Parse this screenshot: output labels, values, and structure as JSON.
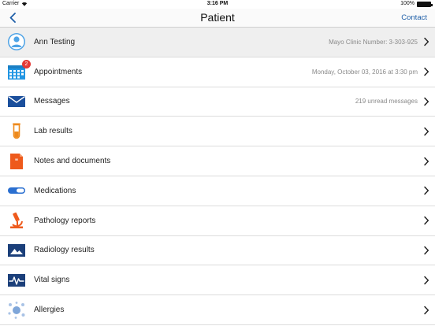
{
  "status_bar": {
    "carrier": "Carrier",
    "time": "3:16 PM",
    "battery": "100%"
  },
  "nav": {
    "title": "Patient",
    "contact": "Contact"
  },
  "rows": [
    {
      "label": "Ann Testing",
      "detail": "Mayo Clinic Number:  3-303-925",
      "icon": "person-icon"
    },
    {
      "label": "Appointments",
      "detail": "Monday, October 03, 2016 at 3:30 pm",
      "icon": "calendar-icon",
      "badge": "2"
    },
    {
      "label": "Messages",
      "detail": "219 unread messages",
      "icon": "envelope-icon"
    },
    {
      "label": "Lab results",
      "detail": "",
      "icon": "test-tube-icon"
    },
    {
      "label": "Notes and documents",
      "detail": "",
      "icon": "document-icon"
    },
    {
      "label": "Medications",
      "detail": "",
      "icon": "pill-icon"
    },
    {
      "label": "Pathology reports",
      "detail": "",
      "icon": "microscope-icon"
    },
    {
      "label": "Radiology results",
      "detail": "",
      "icon": "image-icon"
    },
    {
      "label": "Vital signs",
      "detail": "",
      "icon": "heartbeat-icon"
    },
    {
      "label": "Allergies",
      "detail": "",
      "icon": "allergen-icon"
    }
  ],
  "colors": {
    "accent": "#1f5fa8",
    "orange": "#ee6b1c",
    "navy": "#1b3f7a",
    "badge": "#e53935"
  }
}
